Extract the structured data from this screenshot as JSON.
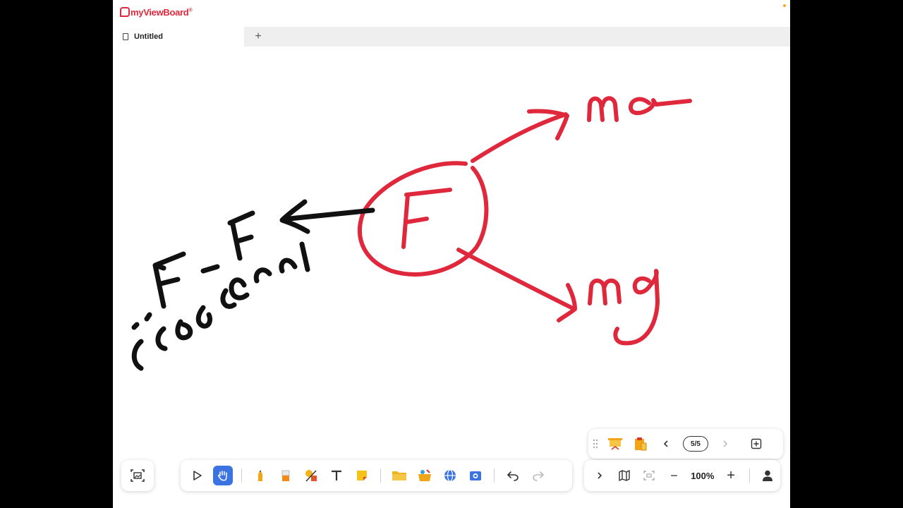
{
  "app": {
    "brand": "myViewBoard",
    "brand_mark": "®",
    "document_tab": "Untitled",
    "new_tab_symbol": "+"
  },
  "canvas": {
    "handwriting": {
      "red_center": "F",
      "red_top_right": "ma",
      "red_bottom_right": "mg",
      "black_expression": "F - F",
      "black_arabic_top": "احتكاك",
      "black_arabic_bottom": "حركة"
    },
    "ink_colors": {
      "red": "#e0283c",
      "black": "#111111"
    }
  },
  "page_nav": {
    "page_indicator": "5/5",
    "prev_icon": "chevron-left",
    "next_icon": "chevron-right",
    "add_page_icon": "plus-square"
  },
  "view_controls": {
    "zoom": "100%",
    "zoom_out_symbol": "−",
    "zoom_in_symbol": "+"
  },
  "toolbar": {
    "active_tool": "hand",
    "accent": "#3b73e0"
  }
}
